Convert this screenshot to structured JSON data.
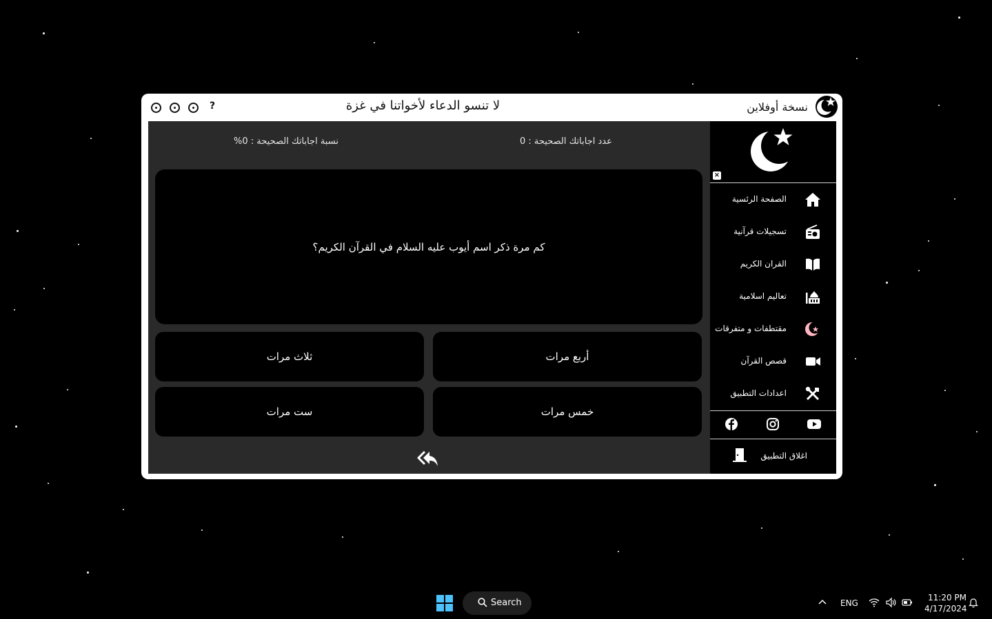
{
  "window": {
    "app_name": "نسخة أوفلاين",
    "banner": "لا تنسو الدعاء لأخواتنا في غزة",
    "help_label": "?"
  },
  "quiz": {
    "correct_count_label": "عدد اجاباتك الصحيحة : 0",
    "correct_percent_label": "نسبة اجاباتك الصحيحة : 0%",
    "question": "كم مرة ذكر اسم أيوب عليه السلام في القرآن الكريم؟",
    "answers": [
      "أربع مرات",
      "ثلاث مرات",
      "خمس مرات",
      "ست مرات"
    ]
  },
  "sidebar": {
    "close_label": "×",
    "items": [
      {
        "label": "الصفحة الرئسية",
        "icon": "home-icon"
      },
      {
        "label": "تسجيلات قرآنية",
        "icon": "radio-icon"
      },
      {
        "label": "القران الكريم",
        "icon": "book-open-icon"
      },
      {
        "label": "تعاليم اسلامية",
        "icon": "mosque-icon"
      },
      {
        "label": "مقتطفات و متفرقات",
        "icon": "crescent-star-icon"
      },
      {
        "label": "قصص القرآن",
        "icon": "video-camera-icon"
      },
      {
        "label": "اعدادات التطبيق",
        "icon": "tools-icon"
      }
    ],
    "social": [
      "facebook-icon",
      "instagram-icon",
      "youtube-icon"
    ],
    "exit_label": "اغلاق التطبيق",
    "accent_color": "#ffb6c1"
  },
  "taskbar": {
    "search_label": "Search",
    "language": "ENG",
    "time": "11:20 PM",
    "date": "4/17/2024"
  }
}
